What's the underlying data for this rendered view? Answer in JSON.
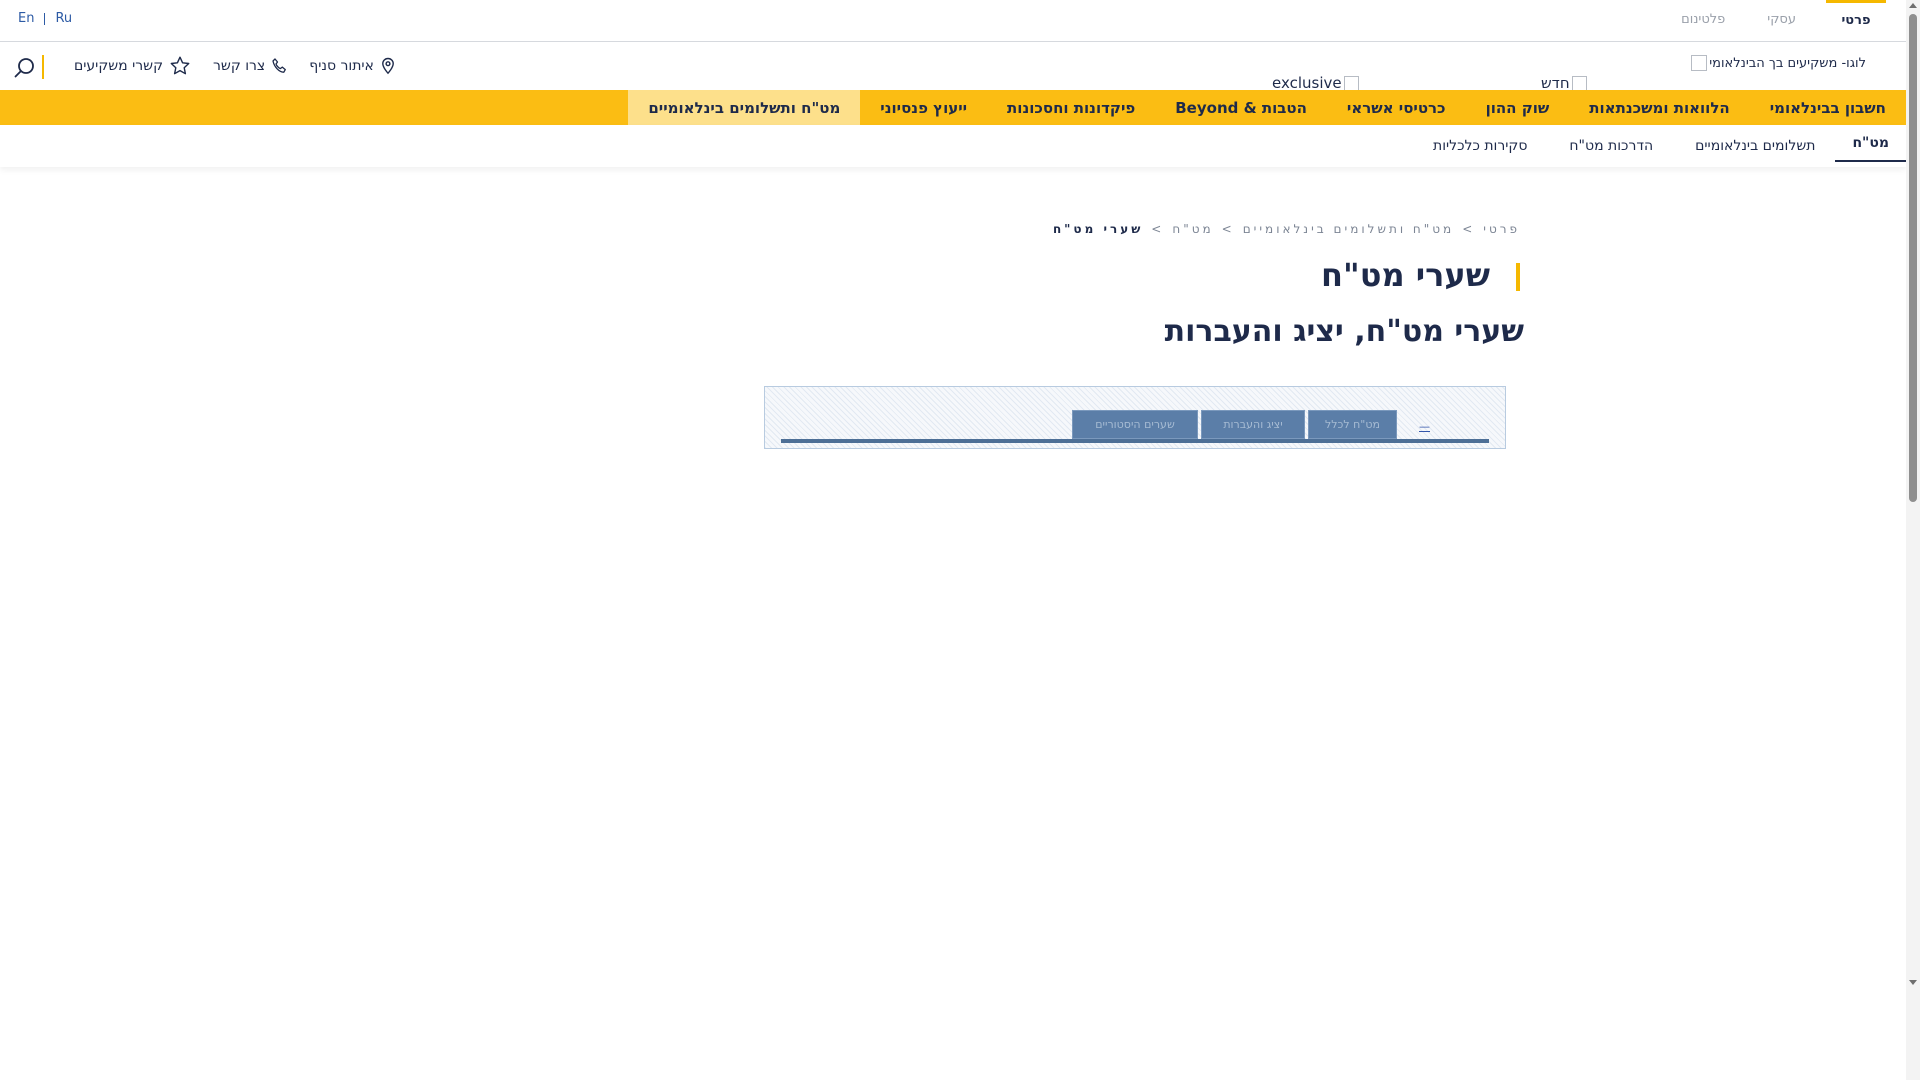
{
  "segment_tabs": [
    "פרטי",
    "עסקי",
    "פלטינום"
  ],
  "language": {
    "en": "En",
    "ru": "Ru"
  },
  "logo_alt": "לוגו- משקיעים בך הבינלאומי",
  "promos": {
    "new": "חדש",
    "exclusive": "exclusive"
  },
  "utility": {
    "branch": "איתור סניף",
    "contact": "צרו קשר",
    "investor_links": "קשרי משקיעים"
  },
  "main_nav": [
    "חשבון בבינלאומי",
    "הלוואות ומשכנתאות",
    "שוק ההון",
    "כרטיסי אשראי",
    "הטבות & Beyond",
    "פיקדונות וחסכונות",
    "ייעוץ פנסיוני",
    "מט\"ח ותשלומים בינלאומיים"
  ],
  "sub_nav": [
    "מט\"ח",
    "תשלומים בינלאומיים",
    "הדרכות מט\"ח",
    "סקירות כלכליות"
  ],
  "breadcrumb": [
    "פרטי",
    ">",
    "מט\"ח ותשלומים בינלאומיים",
    ">",
    "מט\"ח",
    ">",
    "שערי מט\"ח"
  ],
  "page": {
    "title": "שערי מט\"ח",
    "subtitle": "שערי מט\"ח, יציג והעברות"
  },
  "widget": {
    "tabs": [
      "מט\"ח לכלל",
      "יציג והעברות",
      "שערים היסטוריים"
    ],
    "link": "—"
  },
  "colors": {
    "accent": "#fbbd13",
    "navy": "#1e2a4a",
    "active_nav": "#fde08b",
    "widget_tab": "#5b7ea8"
  }
}
